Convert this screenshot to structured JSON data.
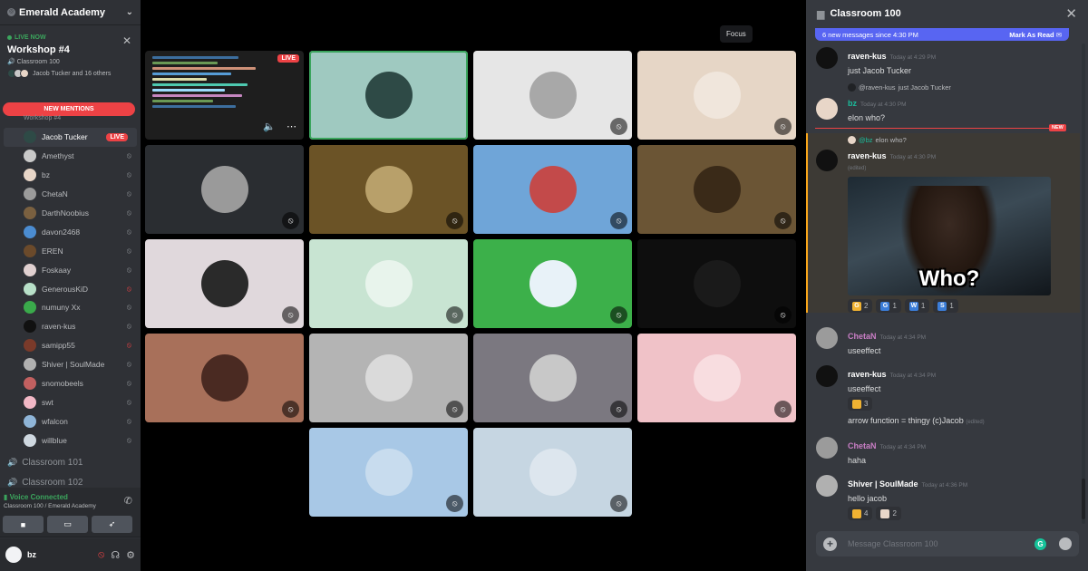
{
  "server": {
    "name": "Emerald Academy"
  },
  "live_card": {
    "badge": "LIVE NOW",
    "title": "Workshop #4",
    "channel": "Classroom 100",
    "participants": "Jacob Tucker and 16 others"
  },
  "mentions_label": "NEW MENTIONS",
  "workshop_label": "Workshop #4",
  "members": [
    {
      "name": "Jacob Tucker",
      "live": "LIVE",
      "color": "#2e4a46"
    },
    {
      "name": "Amethyst",
      "color": "#c9c9c9"
    },
    {
      "name": "bz",
      "color": "#e8d6c8"
    },
    {
      "name": "ChetaN",
      "color": "#9b9b9b"
    },
    {
      "name": "DarthNoobius",
      "color": "#7a6040"
    },
    {
      "name": "davon2468",
      "color": "#4b8cd1"
    },
    {
      "name": "EREN",
      "color": "#6b4a2b"
    },
    {
      "name": "Foskaay",
      "color": "#e0d0d0"
    },
    {
      "name": "GenerousKiD",
      "color": "#b8e0c8",
      "red": true
    },
    {
      "name": "numuny Xx",
      "color": "#3aaa4b"
    },
    {
      "name": "raven-kus",
      "color": "#111111"
    },
    {
      "name": "samipp55",
      "color": "#7a3a2a",
      "red": true
    },
    {
      "name": "Shiver | SoulMade",
      "color": "#b0b0b0"
    },
    {
      "name": "snomobeels",
      "color": "#c26060"
    },
    {
      "name": "swt",
      "color": "#f2b8c6"
    },
    {
      "name": "wfalcon",
      "color": "#8fb5d8"
    },
    {
      "name": "willblue",
      "color": "#cfd8e0"
    }
  ],
  "channels": [
    "Classroom 101",
    "Classroom 102"
  ],
  "voice": {
    "status": "Voice Connected",
    "location": "Classroom 100 / Emerald Academy"
  },
  "user": {
    "name": "bz"
  },
  "focus_tooltip": "Focus",
  "screen_share": {
    "live": "LIVE"
  },
  "tiles": [
    {
      "bg": "#9fc9c0",
      "face": "#2e4a46",
      "speaking": true
    },
    {
      "bg": "#e6e6e6",
      "face": "#a8a8a8"
    },
    {
      "bg": "#e6d6c6",
      "face": "#f0e6dc"
    },
    {
      "bg": "#2a2d31",
      "face": "#9a9a9a"
    },
    {
      "bg": "#6b5326",
      "face": "#b8a06a"
    },
    {
      "bg": "#6fa5d8",
      "face": "#c34a4a"
    },
    {
      "bg": "#6b5535",
      "face": "#3a2a18"
    },
    {
      "bg": "#e0d8dc",
      "face": "#2a2a2a"
    },
    {
      "bg": "#c8e4d2",
      "face": "#e8f4ec"
    },
    {
      "bg": "#3cb04a",
      "face": "#e8f2f8"
    },
    {
      "bg": "#0e0e0e",
      "face": "#1a1a1a"
    },
    {
      "bg": "#a8705a",
      "face": "#4a2a22"
    },
    {
      "bg": "#b4b4b4",
      "face": "#dadada"
    },
    {
      "bg": "#7b7880",
      "face": "#c8c8c8"
    },
    {
      "bg": "#f0c2c8",
      "face": "#f8dde0"
    },
    {
      "bg": "#a8c8e6",
      "face": "#c8dcee"
    },
    {
      "bg": "#c6d6e2",
      "face": "#dde6ee"
    }
  ],
  "chat": {
    "title": "Classroom 100",
    "new_messages": "6 new messages since 4:30 PM",
    "mark_read": "Mark As Read",
    "new_tag": "NEW",
    "messages": [
      {
        "author": "raven-kus",
        "time": "Today at 4:29 PM",
        "text": "just Jacob Tucker"
      },
      {
        "reply_name": "@raven-kus",
        "reply_text": "just Jacob Tucker",
        "author": "bz",
        "time": "Today at 4:30 PM",
        "text": "elon who?"
      },
      {
        "reply_name": "@bz",
        "reply_text": "elon who?",
        "author": "raven-kus",
        "time": "Today at 4:30 PM",
        "edited": "(edited)",
        "gif_caption": "Who?"
      },
      {
        "author": "ChetaN",
        "time": "Today at 4:34 PM",
        "text": "useeffect"
      },
      {
        "author": "raven-kus",
        "time": "Today at 4:34 PM",
        "text": "useeffect",
        "text2": "arrow function = thingy (c)Jacob",
        "edited": "(edited)"
      },
      {
        "author": "ChetaN",
        "time": "Today at 4:34 PM",
        "text": "haha"
      },
      {
        "author": "Shiver | SoulMade",
        "time": "Today at 4:36 PM",
        "text": "hello jacob"
      }
    ],
    "reactions_gif": [
      {
        "icon": "G",
        "color": "#f0b232",
        "count": "2"
      },
      {
        "icon": "G",
        "color": "#3b7dd8",
        "count": "1"
      },
      {
        "icon": "W",
        "color": "#3b7dd8",
        "count": "1"
      },
      {
        "icon": "S",
        "color": "#3b7dd8",
        "count": "1"
      }
    ],
    "reactions_useeffect": [
      {
        "icon": "",
        "color": "#f0b232",
        "count": "3"
      }
    ],
    "reactions_hello": [
      {
        "icon": "",
        "color": "#f0b232",
        "count": "4"
      },
      {
        "icon": "",
        "color": "#e8d6c8",
        "count": "2"
      }
    ],
    "placeholder": "Message Classroom 100"
  }
}
